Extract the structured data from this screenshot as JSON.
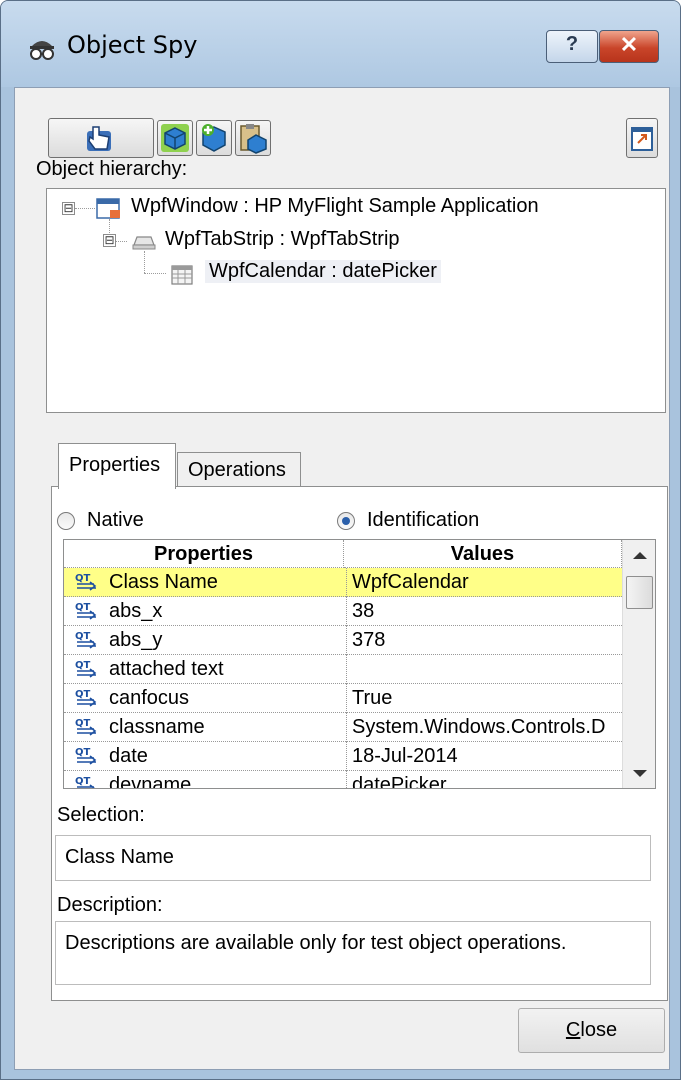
{
  "window": {
    "title": "Object Spy",
    "help_label": "?",
    "close_label": "✕"
  },
  "toolbar": {
    "pointer_icon": "pointing-hand-icon",
    "icons": [
      "highlight-object-icon",
      "add-objects-icon",
      "copy-clipboard-icon"
    ],
    "notes_icon": "pin-window-icon"
  },
  "hierarchy": {
    "label": "Object hierarchy:",
    "nodes": [
      {
        "text": "WpfWindow : HP MyFlight Sample Application",
        "icon": "window-icon",
        "expander": "⊟"
      },
      {
        "text": "WpfTabStrip : WpfTabStrip",
        "icon": "tabstrip-icon",
        "expander": "⊟"
      },
      {
        "text": "WpfCalendar : datePicker",
        "icon": "calendar-icon",
        "selected": true
      }
    ]
  },
  "tabs": [
    {
      "label": "Properties",
      "active": true
    },
    {
      "label": "Operations",
      "active": false
    }
  ],
  "mode": {
    "native_label": "Native",
    "identification_label": "Identification",
    "selected": "Identification"
  },
  "grid": {
    "headers": [
      "Properties",
      "Values"
    ],
    "rows": [
      {
        "property": "Class Name",
        "value": "WpfCalendar",
        "selected": true
      },
      {
        "property": "abs_x",
        "value": "38"
      },
      {
        "property": "abs_y",
        "value": "378"
      },
      {
        "property": "attached text",
        "value": ""
      },
      {
        "property": "canfocus",
        "value": "True"
      },
      {
        "property": "classname",
        "value": "System.Windows.Controls.D"
      },
      {
        "property": "date",
        "value": "18-Jul-2014"
      },
      {
        "property": "devname",
        "value": "datePicker"
      }
    ]
  },
  "selection": {
    "label": "Selection:",
    "value": "Class Name"
  },
  "description": {
    "label": "Description:",
    "value": "Descriptions are available only for test object operations."
  },
  "close_button": {
    "label": "Close",
    "mnemonic": "C"
  },
  "colors": {
    "title_bar": "#b9d1ea",
    "selected_row": "#ffff88",
    "close_x": "#c9452a"
  }
}
